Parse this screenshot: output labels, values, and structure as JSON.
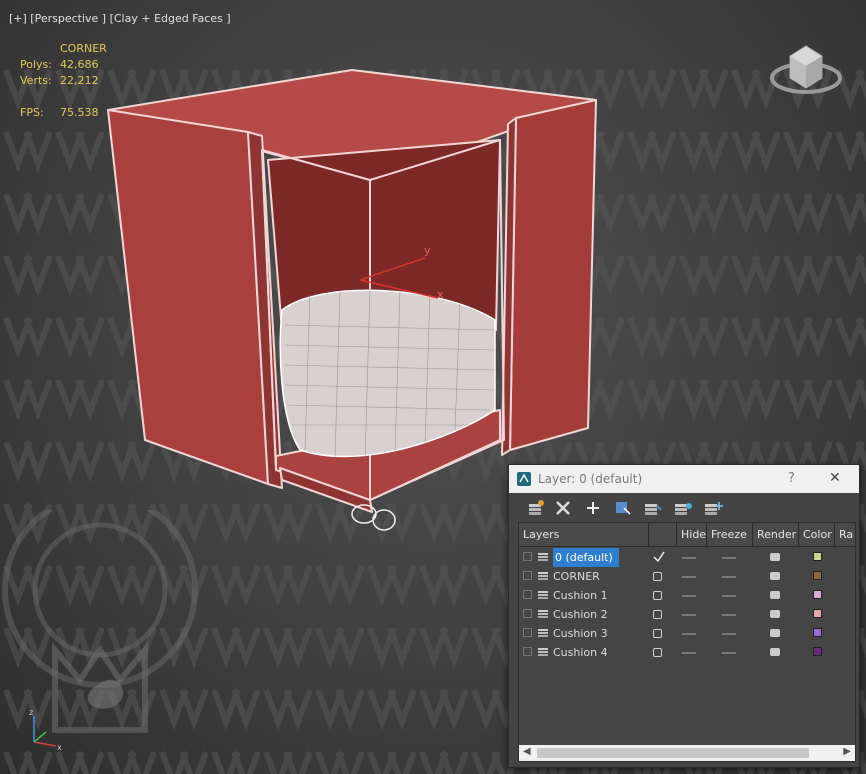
{
  "viewport": {
    "label": "[+] [Perspective ] [Clay + Edged Faces ]",
    "stats": {
      "object": "CORNER",
      "polys_label": "Polys:",
      "polys_value": "42,686",
      "verts_label": "Verts:",
      "verts_value": "22,212",
      "fps_label": "FPS:",
      "fps_value": "75.538"
    },
    "gizmo": {
      "x": "x",
      "y": "y",
      "z": "z"
    }
  },
  "layer_dialog": {
    "title": "Layer: 0 (default)",
    "help": "?",
    "close": "✕",
    "toolbar": [
      "create-layer-icon",
      "delete-icon",
      "add-icon",
      "select-objects-icon",
      "highlight-icon",
      "hide-all-icon",
      "freeze-all-icon"
    ],
    "columns": [
      "Layers",
      "Hide",
      "Freeze",
      "Render",
      "Color",
      "Ra"
    ],
    "rows": [
      {
        "name": "0 (default)",
        "active": true,
        "color": "#c8d88a"
      },
      {
        "name": "CORNER",
        "active": false,
        "color": "#8a6a3a"
      },
      {
        "name": "Cushion 1",
        "active": false,
        "color": "#d8a8d8"
      },
      {
        "name": "Cushion 2",
        "active": false,
        "color": "#e0a8a8"
      },
      {
        "name": "Cushion 3",
        "active": false,
        "color": "#9a6ad8"
      },
      {
        "name": "Cushion 4",
        "active": false,
        "color": "#6a2a7a"
      }
    ]
  }
}
